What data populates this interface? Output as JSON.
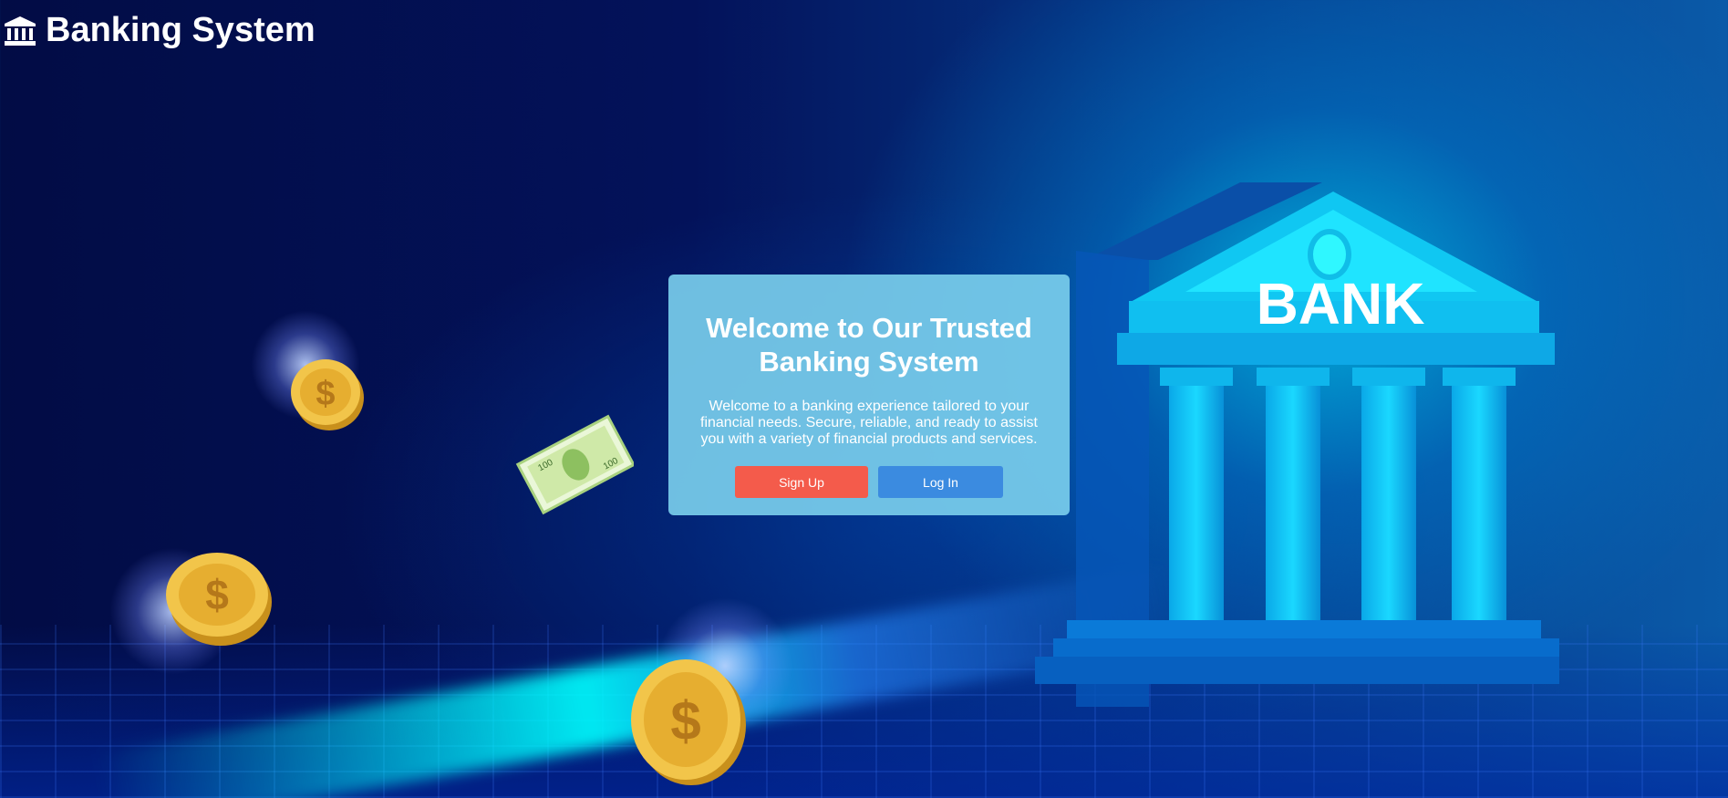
{
  "header": {
    "icon": "bank-icon",
    "title": "Banking System"
  },
  "welcome_card": {
    "heading": "Welcome to Our Trusted Banking System",
    "description": "Welcome to a banking experience tailored to your financial needs. Secure, reliable, and ready to assist you with a variety of financial products and services.",
    "signup_label": "Sign Up",
    "login_label": "Log In"
  },
  "illustration": {
    "sign_text": "BANK",
    "banknote_text": "100",
    "coin_symbol": "$"
  },
  "colors": {
    "signup_button": "#f45b4b",
    "login_button": "#3b8be0",
    "card_background": "#78cdeb",
    "page_background": "#03125a"
  }
}
